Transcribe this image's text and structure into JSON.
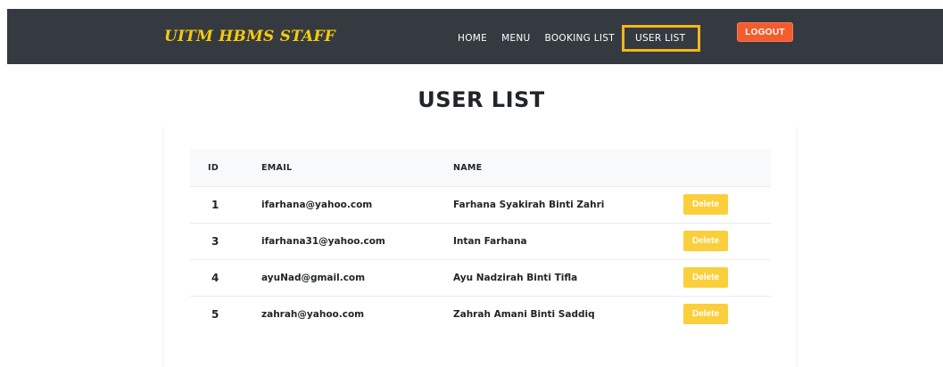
{
  "navbar": {
    "brand": "UITM HBMS STAFF",
    "links": [
      "HOME",
      "MENU",
      "BOOKING LIST",
      "USER LIST"
    ],
    "active_link": "USER LIST",
    "logout_label": "LOGOUT"
  },
  "page": {
    "title": "USER LIST"
  },
  "table": {
    "headers": [
      "ID",
      "EMAIL",
      "NAME",
      ""
    ],
    "rows": [
      {
        "id": "1",
        "email": "ifarhana@yahoo.com",
        "name": "Farhana Syakirah Binti Zahri",
        "action": "Delete"
      },
      {
        "id": "3",
        "email": "ifarhana31@yahoo.com",
        "name": "Intan Farhana",
        "action": "Delete"
      },
      {
        "id": "4",
        "email": "ayuNad@gmail.com",
        "name": "Ayu Nadzirah Binti Tifla",
        "action": "Delete"
      },
      {
        "id": "5",
        "email": "zahrah@yahoo.com",
        "name": "Zahrah Amani Binti Saddiq",
        "action": "Delete"
      }
    ]
  },
  "colors": {
    "navbar_bg": "#343a40",
    "brand": "#f6c90e",
    "active_outline": "#f2b51c",
    "logout_bg": "#f35c2e",
    "delete_bg": "#fbcf3c"
  }
}
